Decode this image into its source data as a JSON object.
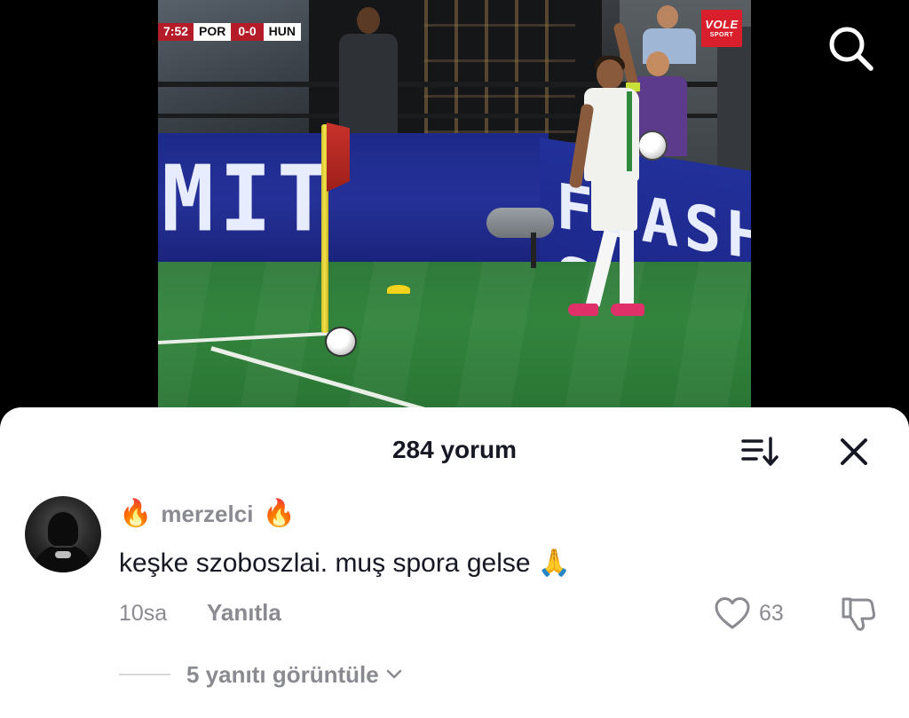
{
  "video": {
    "scoreboard": {
      "clock": "7:52",
      "home": "POR",
      "score": "0-0",
      "away": "HUN"
    },
    "brand": {
      "line1": "VOLE",
      "line2": "SPORT"
    },
    "board_left_text": "MIT",
    "board_right_text": "FLASH S",
    "icons": {
      "search": "search-icon"
    }
  },
  "comments_sheet": {
    "title": "284 yorum",
    "icons": {
      "sort": "sort-icon",
      "close": "close-icon"
    },
    "comment": {
      "username": "merzelci",
      "username_prefix_emoji": "🔥",
      "username_suffix_emoji": "🔥",
      "text": "keşke szoboszlai. muş spora gelse",
      "text_emoji": "🙏",
      "time": "10sa",
      "reply_label": "Yanıtla",
      "like_count": "63",
      "view_replies_label": "5 yanıtı görüntüle"
    }
  },
  "colors": {
    "text_primary": "#161823",
    "text_secondary": "#8a8b91",
    "scoreboard_red": "#b41c2a",
    "brand_red": "#d91f2b"
  }
}
